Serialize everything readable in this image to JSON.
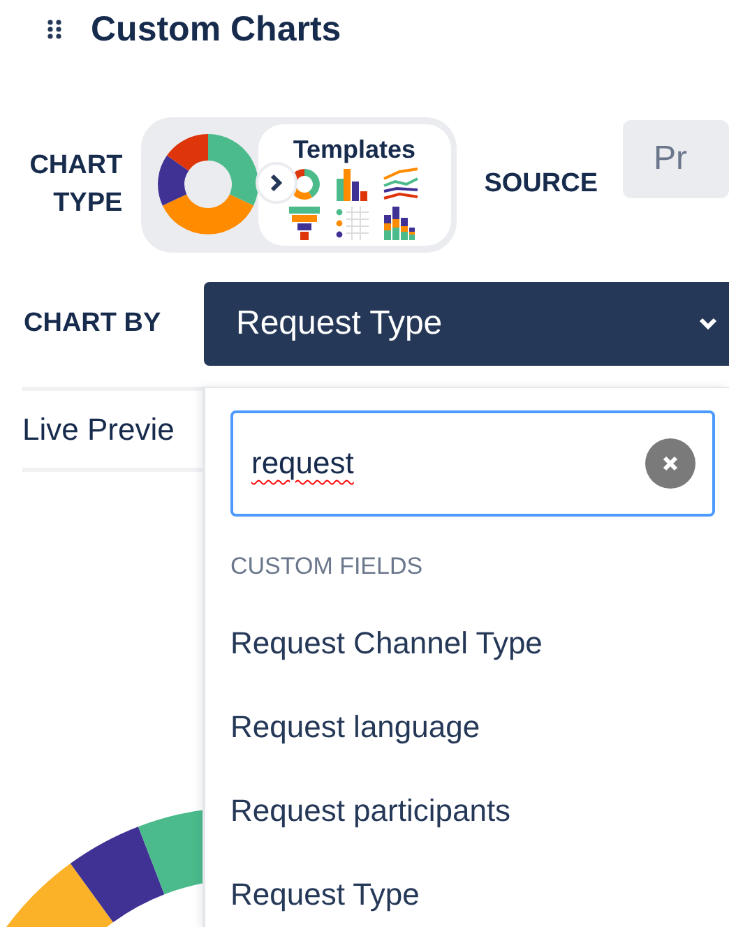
{
  "header": {
    "title": "Custom Charts"
  },
  "chart_type": {
    "label": "CHART TYPE",
    "templates_label": "Templates"
  },
  "source": {
    "label": "SOURCE",
    "value": "Pr"
  },
  "chart_by": {
    "label": "CHART BY",
    "value": "Request Type"
  },
  "preview": {
    "label": "Live Previe"
  },
  "dropdown": {
    "search": {
      "value": "request"
    },
    "group_label": "CUSTOM FIELDS",
    "options": [
      {
        "label": "Request Channel Type"
      },
      {
        "label": "Request language"
      },
      {
        "label": "Request participants"
      },
      {
        "label": "Request Type"
      }
    ]
  }
}
